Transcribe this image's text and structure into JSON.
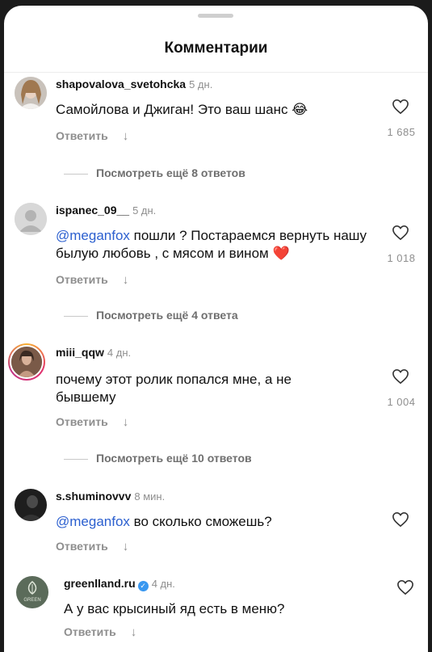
{
  "header": {
    "title": "Комментарии"
  },
  "comments": [
    {
      "username": "shapovalova_svetohcka",
      "time": "5 дн.",
      "mention": "",
      "text": "Самойлова и Джиган! Это ваш шанс 😂",
      "reply_label": "Ответить",
      "likes": "1 685",
      "more_replies": "Посмотреть ещё 8 ответов"
    },
    {
      "username": "ispanec_09__",
      "time": "5 дн.",
      "mention": "@meganfox",
      "text": " пошли ? Постараемся вернуть нашу былую любовь , с мясом и вином ❤️",
      "reply_label": "Ответить",
      "likes": "1 018",
      "more_replies": "Посмотреть ещё 4 ответа"
    },
    {
      "username": "miii_qqw",
      "time": "4 дн.",
      "mention": "",
      "text": "почему этот ролик попался мне, а не бывшему",
      "reply_label": "Ответить",
      "likes": "1 004",
      "more_replies": "Посмотреть ещё 10 ответов"
    },
    {
      "username": "s.shuminovvv",
      "time": "8 мин.",
      "mention": "@meganfox",
      "text": " во сколько сможешь?",
      "reply_label": "Ответить",
      "likes": ""
    },
    {
      "username": "greenlland.ru",
      "time": "4 дн.",
      "mention": "",
      "text": "А у вас крысиный яд есть в меню?",
      "reply_label": "Ответить",
      "likes": "",
      "avatar_label": "GREEN"
    }
  ],
  "colors": {
    "mention": "#2b5fcf",
    "verified": "#3897f0",
    "muted": "#8e8e8e"
  },
  "icons": {
    "like": "heart-outline-icon",
    "replies": "chevron-down-icon",
    "verified": "verified-badge-icon"
  }
}
